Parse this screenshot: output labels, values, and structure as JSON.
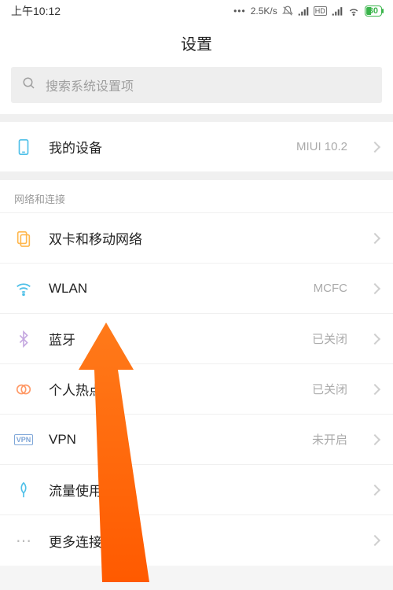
{
  "status": {
    "time": "上午10:12",
    "speed": "2.5K/s",
    "hd": "HD",
    "battery": "30"
  },
  "header": {
    "title": "设置"
  },
  "search": {
    "placeholder": "搜索系统设置项"
  },
  "device": {
    "label": "我的设备",
    "value": "MIUI 10.2"
  },
  "network_section": "网络和连接",
  "rows": {
    "sim": {
      "label": "双卡和移动网络",
      "value": ""
    },
    "wlan": {
      "label": "WLAN",
      "value": "MCFC"
    },
    "bt": {
      "label": "蓝牙",
      "value": "已关闭"
    },
    "hotspot": {
      "label": "个人热点",
      "value": "已关闭"
    },
    "vpn": {
      "label": "VPN",
      "value": "未开启"
    },
    "data": {
      "label": "流量使用情况",
      "value": ""
    },
    "more": {
      "label": "更多连接方式",
      "value": ""
    }
  }
}
